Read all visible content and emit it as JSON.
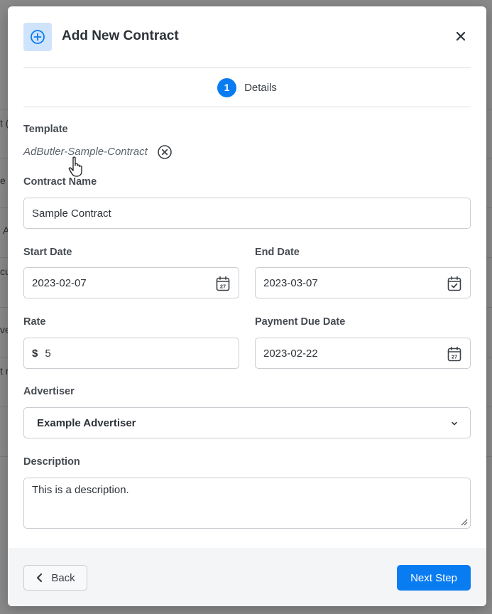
{
  "background_fragments": [
    "t (",
    "e",
    "A",
    "cu",
    "ve",
    "t r"
  ],
  "modal": {
    "title": "Add New Contract",
    "header_icon": "plus-circle-icon",
    "close_icon": "close-icon"
  },
  "stepper": {
    "step_number": "1",
    "step_label": "Details"
  },
  "template": {
    "label": "Template",
    "value": "AdButler-Sample-Contract",
    "clear_icon": "clear-circle-icon"
  },
  "contract_name": {
    "label": "Contract Name",
    "value": "Sample Contract"
  },
  "start_date": {
    "label": "Start Date",
    "value": "2023-02-07",
    "icon_day": "27"
  },
  "end_date": {
    "label": "End Date",
    "value": "2023-03-07"
  },
  "rate": {
    "label": "Rate",
    "currency": "$",
    "value": "5"
  },
  "payment_due_date": {
    "label": "Payment Due Date",
    "value": "2023-02-22",
    "icon_day": "27"
  },
  "advertiser": {
    "label": "Advertiser",
    "selected": "Example Advertiser"
  },
  "description": {
    "label": "Description",
    "value": "This is a description."
  },
  "footer": {
    "back_label": "Back",
    "next_label": "Next Step"
  },
  "colors": {
    "accent": "#0a7cf2",
    "icon_bg": "#cfe3fb",
    "title_text": "#2d3239",
    "overlay": "#8c8c8c"
  }
}
